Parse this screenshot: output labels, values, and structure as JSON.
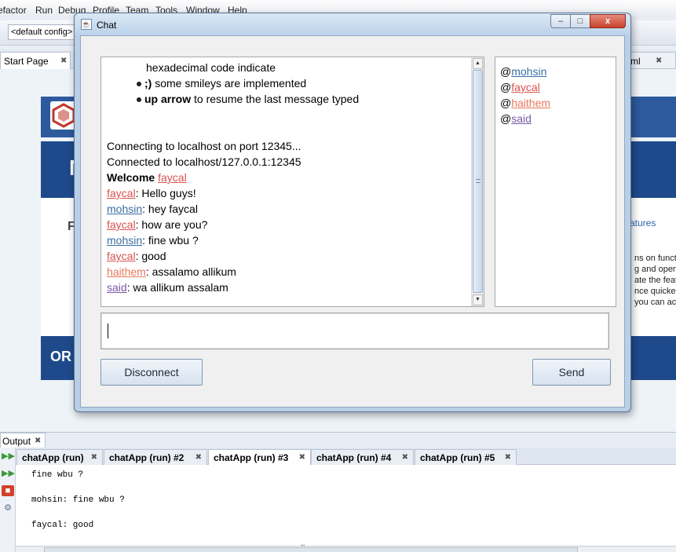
{
  "ide": {
    "menu": [
      "efactor",
      "Run",
      "Debug",
      "Profile",
      "Team",
      "Tools",
      "Window",
      "Help"
    ],
    "config": "<default config>",
    "editor_tab": "Start Page",
    "editor_tab_right": "ml",
    "startpage": {
      "band_text": "M",
      "body_letter": "F",
      "features_link": "atures",
      "para_lines": [
        "ns on functi",
        "g and openin",
        "ate the featu",
        "nce quicker a",
        "you can ac"
      ],
      "footer_text": "OR"
    },
    "output": {
      "title": "Output",
      "tabs": [
        {
          "label": "chatApp (run)"
        },
        {
          "label": "chatApp (run) #2"
        },
        {
          "label": "chatApp (run) #3"
        },
        {
          "label": "chatApp (run) #4"
        },
        {
          "label": "chatApp (run) #5"
        }
      ],
      "console_lines": [
        "fine wbu ?",
        "mohsin: fine wbu ?",
        "faycal: good"
      ],
      "scroll_marker": "'''"
    }
  },
  "chat": {
    "title": "Chat",
    "window_buttons": {
      "minimize": "–",
      "maximize": "□",
      "close": "x"
    },
    "messages": {
      "info_line": "hexadecimal code indicate",
      "tips": [
        {
          "bold": ";)",
          "text": " some smileys are implemented"
        },
        {
          "bold": "up arrow",
          "text": " to resume the last message typed"
        }
      ],
      "status": [
        "Connecting to localhost on port 12345...",
        "Connected to localhost/127.0.0.1:12345"
      ],
      "welcome_label": "Welcome",
      "welcome_user": "faycal",
      "chat_lines": [
        {
          "user": "faycal",
          "text": ": Hello guys!",
          "color": "#d9534f"
        },
        {
          "user": "mohsin",
          "text": ": hey faycal",
          "color": "#3a6ea5"
        },
        {
          "user": "faycal",
          "text": ": how are you?",
          "color": "#d9534f"
        },
        {
          "user": "mohsin",
          "text": ": fine wbu ?",
          "color": "#3a6ea5"
        },
        {
          "user": "faycal",
          "text": ": good",
          "color": "#d9534f"
        },
        {
          "user": "haithem",
          "text": ": assalamo allikum",
          "color": "#e9775a"
        },
        {
          "user": "said",
          "text": ": wa allikum assalam",
          "color": "#7b5aa6"
        }
      ]
    },
    "users": [
      {
        "prefix": "@",
        "name": "mohsin",
        "color": "#3a6ea5"
      },
      {
        "prefix": "@",
        "name": "faycal",
        "color": "#d9534f"
      },
      {
        "prefix": "@",
        "name": "haithem",
        "color": "#e9775a"
      },
      {
        "prefix": "@",
        "name": "said",
        "color": "#7b5aa6"
      }
    ],
    "input_value": "",
    "disconnect_label": "Disconnect",
    "send_label": "Send"
  }
}
